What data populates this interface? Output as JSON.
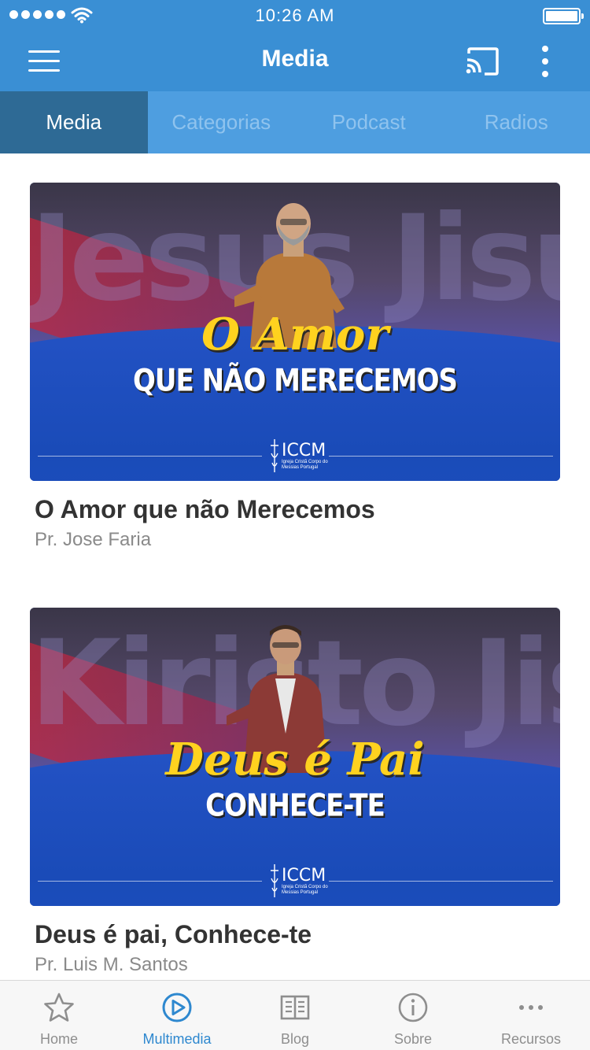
{
  "status_bar": {
    "time": "10:26 AM"
  },
  "app_bar": {
    "title": "Media"
  },
  "tabs": [
    {
      "label": "Media",
      "active": true
    },
    {
      "label": "Categorias",
      "active": false
    },
    {
      "label": "Podcast",
      "active": false
    },
    {
      "label": "Radios",
      "active": false
    }
  ],
  "media": [
    {
      "title": "O Amor que não Merecemos",
      "author": "Pr. Jose Faria",
      "thumb_headline": "O Amor",
      "thumb_subline": "QUE NÃO MERECEMOS",
      "thumb_bg_text": "Jesus Jisus",
      "thumb_logo": "ICCM",
      "thumb_logo_sub": "Igreja Cristã Corpo do Messias Portugal"
    },
    {
      "title": "Deus é pai, Conhece-te",
      "author": "Pr. Luis M. Santos",
      "thumb_headline": "Deus é Pai",
      "thumb_subline": "CONHECE-TE",
      "thumb_bg_text": "Kiristo Jisus",
      "thumb_logo": "ICCM",
      "thumb_logo_sub": "Igreja Cristã Corpo do Messias Portugal"
    }
  ],
  "bottom_nav": [
    {
      "label": "Home",
      "icon": "star-icon",
      "active": false
    },
    {
      "label": "Multimedia",
      "icon": "play-circle-icon",
      "active": true
    },
    {
      "label": "Blog",
      "icon": "book-icon",
      "active": false
    },
    {
      "label": "Sobre",
      "icon": "info-icon",
      "active": false
    },
    {
      "label": "Recursos",
      "icon": "more-horizontal-icon",
      "active": false
    }
  ],
  "colors": {
    "primary": "#3a8fd4",
    "tab_bar": "#4e9ee0",
    "tab_active": "#2e6a95",
    "nav_active": "#2e88cf",
    "headline_yellow": "#ffd21f"
  }
}
